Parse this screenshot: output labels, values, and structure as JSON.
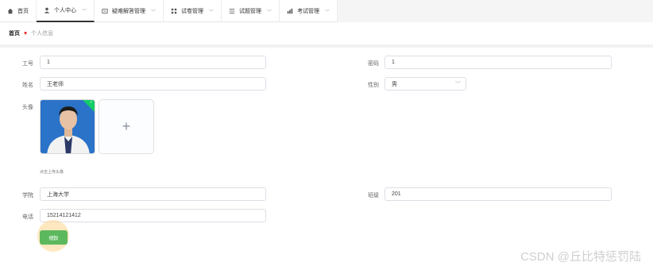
{
  "nav": {
    "items": [
      {
        "label": "首页",
        "icon": "home-icon"
      },
      {
        "label": "个人中心",
        "icon": "user-icon",
        "active": true
      },
      {
        "label": "疑难解答管理",
        "icon": "qa-icon"
      },
      {
        "label": "试卷管理",
        "icon": "grid-icon"
      },
      {
        "label": "试题管理",
        "icon": "list-icon"
      },
      {
        "label": "考试管理",
        "icon": "exam-icon"
      }
    ]
  },
  "breadcrumb": {
    "home": "首页",
    "current": "个人信息"
  },
  "form": {
    "id_label": "工号",
    "id_value": "1",
    "password_label": "密码",
    "password_value": "1",
    "name_label": "姓名",
    "name_value": "王老师",
    "gender_label": "性别",
    "gender_value": "男",
    "avatar_label": "头像",
    "avatar_tip": "点击上传头像",
    "college_label": "学院",
    "college_value": "上海大学",
    "class_label": "班级",
    "class_value": "201",
    "phone_label": "电话",
    "phone_value": "15214121412",
    "submit_label": "修改"
  },
  "watermark": "CSDN @丘比特惩罚陆",
  "colors": {
    "accent": "#5cb85c",
    "success_flag": "#13ce66",
    "photo_bg": "#2b73c8"
  }
}
